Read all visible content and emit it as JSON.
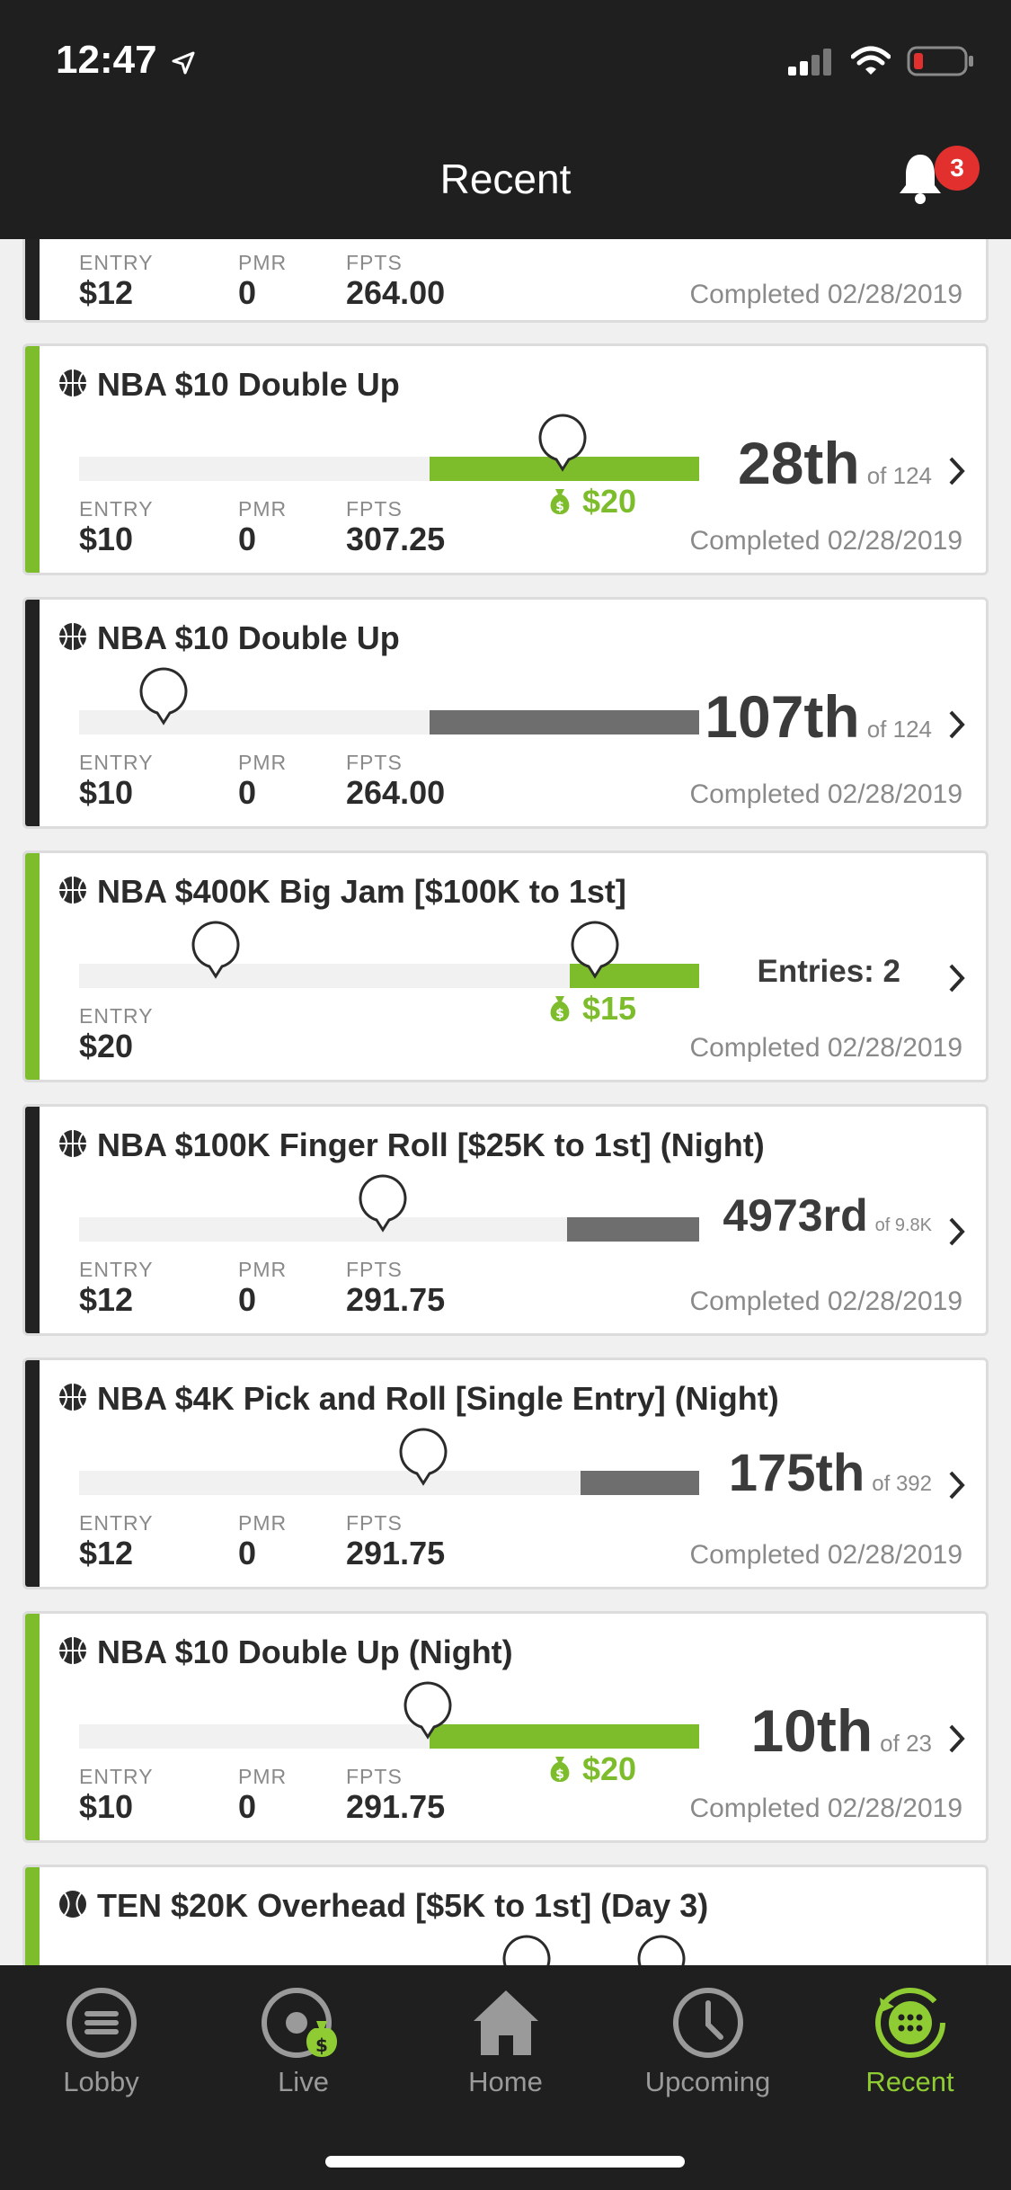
{
  "status_bar": {
    "time": "12:47"
  },
  "header": {
    "title": "Recent",
    "notification_count": "3"
  },
  "stat_labels": {
    "entry": "ENTRY",
    "pmr": "PMR",
    "fpts": "FPTS"
  },
  "cards": [
    {
      "entry": "$12",
      "pmr": "0",
      "fpts": "264.00",
      "completed": "Completed 02/28/2019"
    },
    {
      "title": "NBA $10 Double Up",
      "progress": 0.44,
      "prize": "$20",
      "rank": "28th",
      "rank_of": "of 124",
      "entry": "$10",
      "pmr": "0",
      "fpts": "307.25",
      "completed": "Completed 02/28/2019"
    },
    {
      "title": "NBA $10 Double Up",
      "rank": "107th",
      "rank_of": "of 124",
      "entry": "$10",
      "pmr": "0",
      "fpts": "264.00",
      "completed": "Completed 02/28/2019"
    },
    {
      "title": "NBA $400K Big Jam [$100K to 1st]",
      "progress": 0.21,
      "prize": "$15",
      "entries": "Entries: 2",
      "entry": "$20",
      "completed": "Completed 02/28/2019"
    },
    {
      "title": "NBA $100K Finger Roll [$25K to 1st] (Night)",
      "rank": "4973rd",
      "rank_of": "of 9.8K",
      "entry": "$12",
      "pmr": "0",
      "fpts": "291.75",
      "completed": "Completed 02/28/2019"
    },
    {
      "title": "NBA $4K Pick and Roll [Single Entry] (Night)",
      "rank": "175th",
      "rank_of": "of 392",
      "entry": "$12",
      "pmr": "0",
      "fpts": "291.75",
      "completed": "Completed 02/28/2019"
    },
    {
      "title": "NBA $10 Double Up (Night)",
      "progress": 0.44,
      "prize": "$20",
      "rank": "10th",
      "rank_of": "of 23",
      "entry": "$10",
      "pmr": "0",
      "fpts": "291.75",
      "completed": "Completed 02/28/2019"
    },
    {
      "title": "TEN $20K Overhead [$5K to 1st] (Day 3)"
    }
  ],
  "nav": {
    "items": [
      {
        "label": "Lobby",
        "icon": "lobby-icon"
      },
      {
        "label": "Live",
        "icon": "live-icon"
      },
      {
        "label": "Home",
        "icon": "home-icon"
      },
      {
        "label": "Upcoming",
        "icon": "clock-icon"
      },
      {
        "label": "Recent",
        "icon": "recent-icon"
      }
    ]
  },
  "colors": {
    "win": "#7dbd2c",
    "loss": "#222222",
    "loss_fill": "#6e6e6e",
    "header_bg": "#1f1f1f",
    "badge": "#e2302f"
  }
}
